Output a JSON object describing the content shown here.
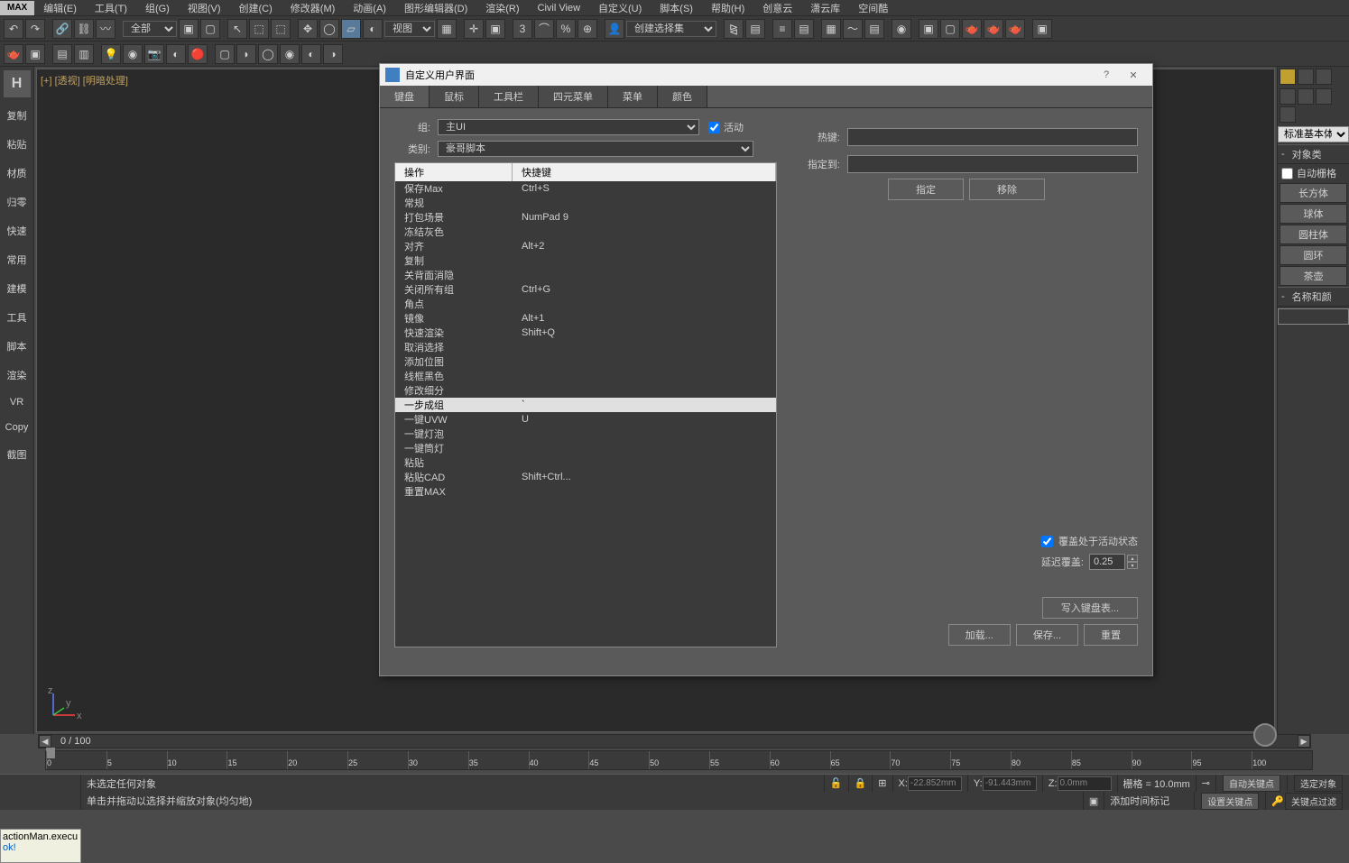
{
  "app": {
    "max_label": "MAX"
  },
  "menu": {
    "items": [
      "编辑(E)",
      "工具(T)",
      "组(G)",
      "视图(V)",
      "创建(C)",
      "修改器(M)",
      "动画(A)",
      "图形编辑器(D)",
      "渲染(R)",
      "Civil View",
      "自定义(U)",
      "脚本(S)",
      "帮助(H)",
      "创意云",
      "潇云库",
      "空间酷"
    ]
  },
  "toolbar1": {
    "all_dropdown": "全部",
    "view_dropdown": "视图",
    "create_set": "创建选择集"
  },
  "left_sidebar": {
    "items": [
      "复制",
      "粘贴",
      "材质",
      "归零",
      "快速",
      "常用",
      "建模",
      "工具",
      "脚本",
      "渲染",
      "VR",
      "Copy",
      "截图"
    ]
  },
  "viewport": {
    "label": "[+] [透视] [明暗处理]"
  },
  "right_panel": {
    "dropdown1": "标准基本体",
    "section1": "对象类",
    "autogrid": "自动栅格",
    "buttons": [
      "长方体",
      "球体",
      "圆柱体",
      "圆环",
      "茶壶"
    ],
    "section2": "名称和颜"
  },
  "dialog": {
    "title": "自定义用户界面",
    "tabs": [
      "键盘",
      "鼠标",
      "工具栏",
      "四元菜单",
      "菜单",
      "颜色"
    ],
    "group_label": "组:",
    "group_value": "主UI",
    "active_label": "活动",
    "category_label": "类别:",
    "category_value": "豪哥脚本",
    "col_action": "操作",
    "col_shortcut": "快捷键",
    "actions": [
      {
        "name": "保存Max",
        "key": "Ctrl+S"
      },
      {
        "name": "常规",
        "key": ""
      },
      {
        "name": "打包场景",
        "key": "NumPad 9"
      },
      {
        "name": "冻结灰色",
        "key": ""
      },
      {
        "name": "对齐",
        "key": "Alt+2"
      },
      {
        "name": "复制",
        "key": ""
      },
      {
        "name": "关背面消隐",
        "key": ""
      },
      {
        "name": "关闭所有组",
        "key": "Ctrl+G"
      },
      {
        "name": "角点",
        "key": ""
      },
      {
        "name": "镜像",
        "key": "Alt+1"
      },
      {
        "name": "快速渲染",
        "key": "Shift+Q"
      },
      {
        "name": "取消选择",
        "key": ""
      },
      {
        "name": "添加位图",
        "key": ""
      },
      {
        "name": "线框黑色",
        "key": ""
      },
      {
        "name": "修改细分",
        "key": ""
      },
      {
        "name": "一步成组",
        "key": "`",
        "selected": true
      },
      {
        "name": "一键UVW",
        "key": "U"
      },
      {
        "name": "一键灯泡",
        "key": ""
      },
      {
        "name": "一键筒灯",
        "key": ""
      },
      {
        "name": "粘贴",
        "key": ""
      },
      {
        "name": "粘贴CAD",
        "key": "Shift+Ctrl..."
      },
      {
        "name": "重置MAX",
        "key": ""
      }
    ],
    "hotkey_label": "热键:",
    "assigned_label": "指定到:",
    "assign_btn": "指定",
    "remove_btn": "移除",
    "override_label": "覆盖处于活动状态",
    "delay_label": "延迟覆盖:",
    "delay_value": "0.25",
    "write_btn": "写入键盘表...",
    "load_btn": "加载...",
    "save_btn": "保存...",
    "reset_btn": "重置"
  },
  "timeline": {
    "frame_text": "0 / 100",
    "ticks": [
      "0",
      "5",
      "10",
      "15",
      "20",
      "25",
      "30",
      "35",
      "40",
      "45",
      "50",
      "55",
      "60",
      "65",
      "70",
      "75",
      "80",
      "85",
      "90",
      "95",
      "100"
    ]
  },
  "status": {
    "script1": "actionMan.execu",
    "script2": "ok!",
    "no_selection": "未选定任何对象",
    "hint": "单击并拖动以选择并缩放对象(均匀地)",
    "x_label": "X:",
    "x_val": "-22.852mm",
    "y_label": "Y:",
    "y_val": "-91.443mm",
    "z_label": "Z:",
    "z_val": "0.0mm",
    "grid_label": "栅格 = 10.0mm",
    "add_time": "添加时间标记",
    "auto_key": "自动关键点",
    "selected_obj": "选定对象",
    "set_key": "设置关键点",
    "key_filter": "关键点过滤"
  }
}
